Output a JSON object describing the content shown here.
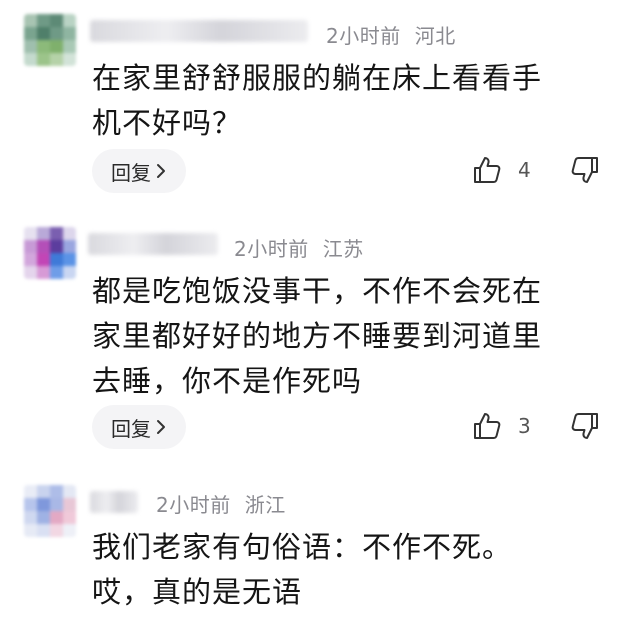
{
  "comments": [
    {
      "time": "2小时前",
      "location": "河北",
      "text_lines": [
        "在家里舒舒服服的躺在床上看看手",
        "机不好吗？"
      ],
      "reply_label": "回复",
      "likes": "4"
    },
    {
      "time": "2小时前",
      "location": "江苏",
      "text_lines": [
        "都是吃饱饭没事干，不作不会死在",
        "家里都好好的地方不睡要到河道里",
        "去睡，你不是作死吗"
      ],
      "reply_label": "回复",
      "likes": "3"
    },
    {
      "time": "2小时前",
      "location": "浙江",
      "text_lines": [
        "我们老家有句俗语：不作不死。",
        "哎，真的是无语"
      ]
    }
  ],
  "icons": {
    "like": "thumbs-up-outline",
    "dislike": "thumbs-down-outline",
    "reply_chevron": "chevron-right"
  },
  "colors": {
    "meta_text": "#8a8a90",
    "reply_bg": "#f4f4f6",
    "icon_stroke": "#333333"
  }
}
